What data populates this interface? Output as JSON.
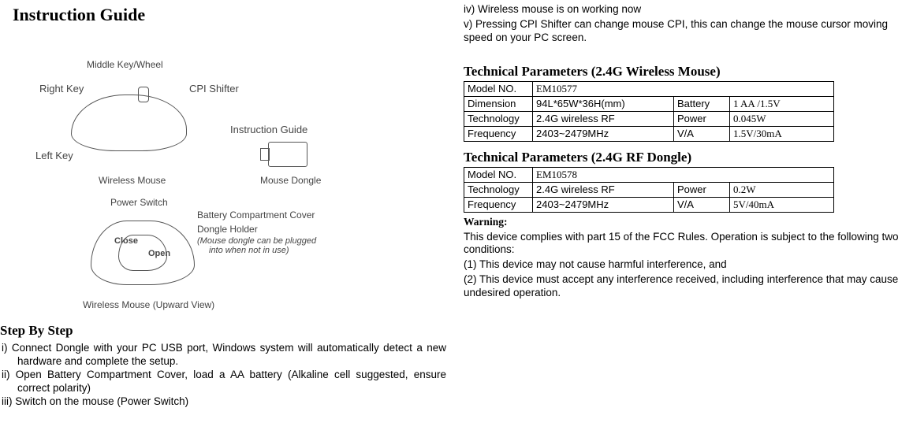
{
  "title": "Instruction Guide",
  "diagram1": {
    "middleKey": "Middle Key/Wheel",
    "rightKey": "Right Key",
    "cpiShifter": "CPI Shifter",
    "instructionGuide": "Instruction Guide",
    "leftKey": "Left Key",
    "wirelessMouse": "Wireless Mouse",
    "mouseDongle": "Mouse Dongle"
  },
  "diagram2": {
    "powerSwitch": "Power Switch",
    "batteryCover": "Battery Compartment Cover",
    "dongleHolder": "Dongle Holder",
    "noteLine1": "(Mouse dongle can be plugged",
    "noteLine2": "into when not in use)",
    "close": "Close",
    "open": "Open",
    "upwardView": "Wireless Mouse (Upward View)"
  },
  "stepsTitle": "Step By Step",
  "steps": [
    {
      "marker": "i)",
      "text": "Connect Dongle with your PC USB port, Windows system will automatically detect a new hardware and complete the setup."
    },
    {
      "marker": "ii)",
      "text": "Open Battery Compartment Cover,  load a AA battery (Alkaline cell suggested, ensure correct polarity)"
    },
    {
      "marker": "iii)",
      "text": "Switch on the mouse (Power Switch)"
    }
  ],
  "continuedSteps": [
    {
      "marker": "iv)",
      "text": "Wireless mouse is on working now"
    },
    {
      "marker": "v)",
      "text": "Pressing CPI Shifter can change mouse CPI, this can change the mouse cursor moving speed on your PC screen."
    }
  ],
  "mouseSpecTitle": "Technical Parameters (2.4G Wireless Mouse)",
  "mouseSpec": {
    "modelNoLabel": "Model NO.",
    "modelNo": "EM10577",
    "dimensionLabel": "Dimension",
    "dimension": "94L*65W*36H(mm)",
    "batteryLabel": "Battery",
    "battery": "1 AA /1.5V",
    "technologyLabel": "Technology",
    "technology": "2.4G wireless RF",
    "powerLabel": "Power",
    "power": "0.045W",
    "frequencyLabel": "Frequency",
    "frequency": "2403~2479MHz",
    "vaLabel": "V/A",
    "va": "1.5V/30mA"
  },
  "dongleSpecTitle": "Technical Parameters (2.4G RF Dongle)",
  "dongleSpec": {
    "modelNoLabel": "Model NO.",
    "modelNo": "EM10578",
    "technologyLabel": "Technology",
    "technology": "2.4G wireless RF",
    "powerLabel": "Power",
    "power": "0.2W",
    "frequencyLabel": "Frequency",
    "frequency": "2403~2479MHz",
    "vaLabel": "V/A",
    "va": "5V/40mA"
  },
  "warning": {
    "title": "Warning:",
    "l1": "This device complies with part 15 of the FCC Rules. Operation is subject to the following two conditions:",
    "l2": "(1) This device may not cause harmful interference, and",
    "l3": "(2) This device must accept any interference received, including interference that may cause undesired operation."
  }
}
